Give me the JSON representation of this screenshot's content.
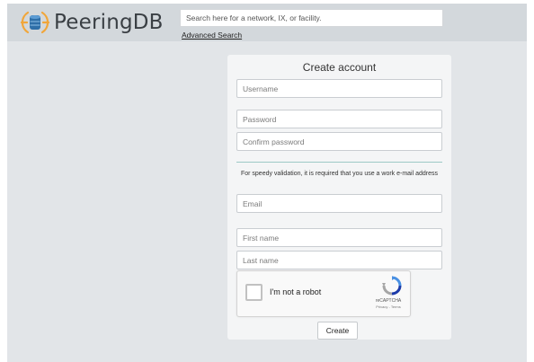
{
  "header": {
    "brand": "PeeringDB",
    "search_placeholder": "Search here for a network, IX, or facility.",
    "advanced_search": "Advanced Search"
  },
  "form": {
    "title": "Create account",
    "username_placeholder": "Username",
    "password_placeholder": "Password",
    "confirm_password_placeholder": "Confirm password",
    "note": "For speedy validation, it is required that you use a work e-mail address",
    "email_placeholder": "Email",
    "first_name_placeholder": "First name",
    "last_name_placeholder": "Last name",
    "captcha": {
      "label": "I'm not a robot",
      "brand": "reCAPTCHA",
      "terms": "Privacy - Terms"
    },
    "submit_label": "Create"
  },
  "colors": {
    "page_bg": "#e2e5e8",
    "header_bg": "#d3d8dc",
    "logo_orange": "#f1a63a",
    "logo_blue": "#2f6fa8",
    "divider_teal": "#9dc9c6"
  },
  "icons": {
    "logo": "peeringdb-logo-icon",
    "captcha": "recaptcha-icon"
  }
}
